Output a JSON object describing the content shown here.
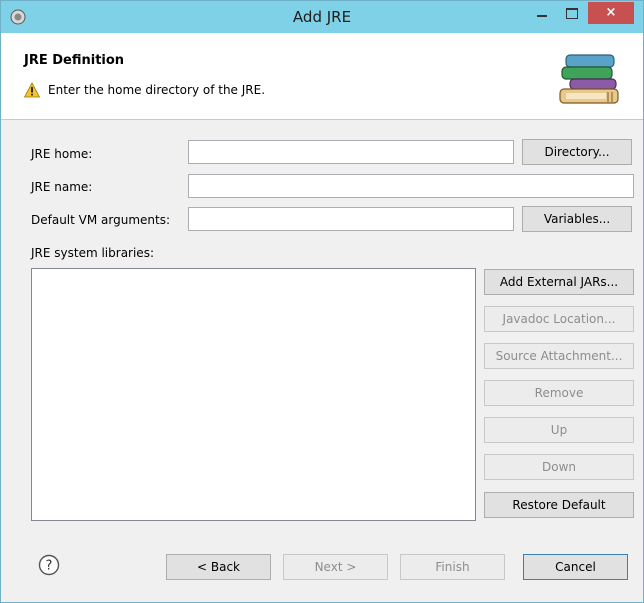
{
  "window": {
    "title": "Add JRE"
  },
  "titlebar": {
    "close_glyph": "×"
  },
  "header": {
    "title": "JRE Definition",
    "message": "Enter the home directory of the JRE.",
    "message_icon": "warning-icon",
    "banner_icon": "books-icon"
  },
  "form": {
    "jre_home": {
      "label": "JRE home:",
      "value": "",
      "button": "Directory..."
    },
    "jre_name": {
      "label": "JRE name:",
      "value": ""
    },
    "vm_args": {
      "label": "Default VM arguments:",
      "value": "",
      "button": "Variables..."
    },
    "libraries_label": "JRE system libraries:",
    "libraries": []
  },
  "library_buttons": {
    "add_external_jars": "Add External JARs...",
    "javadoc_location": "Javadoc Location...",
    "source_attachment": "Source Attachment...",
    "remove": "Remove",
    "up": "Up",
    "down": "Down",
    "restore_default": "Restore Default"
  },
  "footer": {
    "help_icon": "help-icon",
    "back": "< Back",
    "next": "Next >",
    "finish": "Finish",
    "cancel": "Cancel"
  },
  "colors": {
    "titlebar": "#7ed1e6",
    "close_button": "#c75050",
    "dialog_bg": "#f0f0f0",
    "header_bg": "#ffffff"
  }
}
